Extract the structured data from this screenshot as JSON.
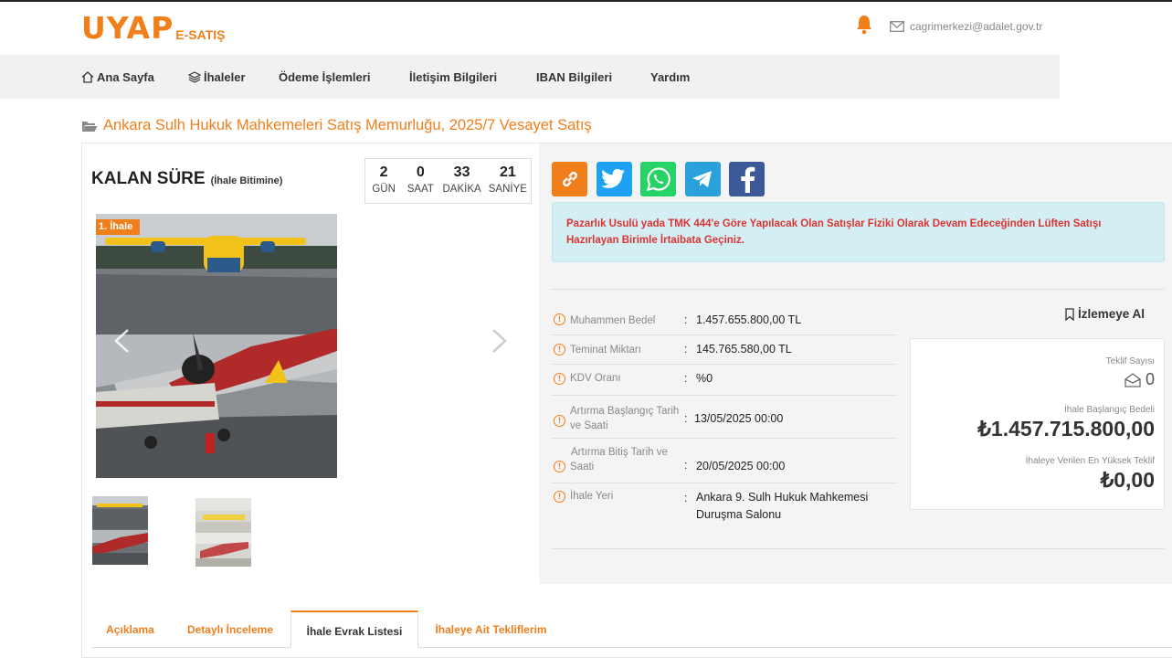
{
  "header": {
    "logo_main": "UYAP",
    "logo_sub": "E-SATIŞ",
    "email": "cagrimerkezi@adalet.gov.tr"
  },
  "nav": {
    "items": [
      "Ana Sayfa",
      "İhaleler",
      "Ödeme İşlemleri",
      "İletişim Bilgileri",
      "IBAN Bilgileri",
      "Yardım"
    ]
  },
  "breadcrumb": "Ankara Sulh Hukuk Mahkemeleri Satış Memurluğu, 2025/7 Vesayet Satış",
  "countdown_section": {
    "title": "KALAN SÜRE",
    "subtitle": "(İhale Bitimine)",
    "units": [
      {
        "value": "2",
        "label": "GÜN"
      },
      {
        "value": "0",
        "label": "SAAT"
      },
      {
        "value": "33",
        "label": "DAKİKA"
      },
      {
        "value": "21",
        "label": "SANİYE"
      }
    ]
  },
  "gallery": {
    "badge": "1. İhale"
  },
  "share_icons": [
    "link-icon",
    "twitter-icon",
    "whatsapp-icon",
    "telegram-icon",
    "facebook-icon"
  ],
  "notice": "Pazarlık Usulü yada TMK 444'e Göre Yapılacak Olan Satışlar Fiziki Olarak Devam Edeceğinden Lüften Satışı Hazırlayan Birimle İrtaibata Geçiniz.",
  "details": [
    {
      "label": "Muhammen Bedel",
      "value": "1.457.655.800,00 TL"
    },
    {
      "label": "Teminat Miktarı",
      "value": "145.765.580,00 TL"
    },
    {
      "label": "KDV Oranı",
      "value": "%0"
    },
    {
      "label": "Artırma Başlangıç Tarih ve Saati",
      "value": "13/05/2025 00:00"
    },
    {
      "label": "Artırma Bitiş Tarih ve Saati",
      "value": "20/05/2025 00:00"
    },
    {
      "label": "İhale Yeri",
      "value": "Ankara 9. Sulh Hukuk Mahkemesi Duruşma Salonu"
    }
  ],
  "watch_label": "İzlemeye Al",
  "bid_box": {
    "offer_count_label": "Teklif Sayısı",
    "offer_count": "0",
    "start_price_label": "İhale Başlangıç Bedeli",
    "start_price": "₺1.457.715.800,00",
    "highest_bid_label": "İhaleye Verilen En Yüksek Teklif",
    "highest_bid": "₺0,00"
  },
  "tabs": [
    "Açıklama",
    "Detaylı İnceleme",
    "İhale Evrak Listesi",
    "İhaleye Ait Tekliflerim"
  ],
  "colors": {
    "accent": "#f07f1b",
    "notice_bg": "#d3eff3",
    "notice_text": "#dd3333"
  }
}
